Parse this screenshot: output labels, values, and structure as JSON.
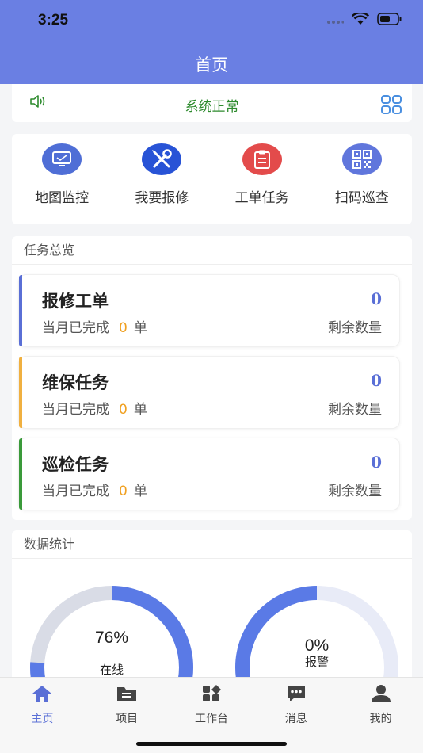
{
  "status_bar": {
    "time": "3:25"
  },
  "header": {
    "title": "首页"
  },
  "notice": {
    "status_text": "系统正常"
  },
  "quick_actions": [
    {
      "label": "地图监控",
      "icon": "monitor-icon",
      "color": "#4f6ed6"
    },
    {
      "label": "我要报修",
      "icon": "wrench-screwdriver-icon",
      "color": "#2853d6"
    },
    {
      "label": "工单任务",
      "icon": "clipboard-icon",
      "color": "#e34b4b"
    },
    {
      "label": "扫码巡查",
      "icon": "qr-code-icon",
      "color": "#6076dc"
    }
  ],
  "overview": {
    "title": "任务总览",
    "tasks": [
      {
        "name": "报修工单",
        "count": "0",
        "done_prefix": "当月已完成",
        "done_value": "0",
        "done_unit": "单",
        "remain_label": "剩余数量",
        "accent": "#5a6fd6"
      },
      {
        "name": "维保任务",
        "count": "0",
        "done_prefix": "当月已完成",
        "done_value": "0",
        "done_unit": "单",
        "remain_label": "剩余数量",
        "accent": "#f0b040"
      },
      {
        "name": "巡检任务",
        "count": "0",
        "done_prefix": "当月已完成",
        "done_value": "0",
        "done_unit": "单",
        "remain_label": "剩余数量",
        "accent": "#3a9a3a"
      }
    ]
  },
  "stats": {
    "title": "数据统计",
    "gauges": [
      {
        "percent": "76%",
        "label": "在线",
        "fraction": 0.76
      },
      {
        "percent": "0%",
        "label": "报警",
        "fraction": 0.0
      }
    ]
  },
  "tabbar": {
    "items": [
      {
        "label": "主页",
        "icon": "home-icon",
        "active": true
      },
      {
        "label": "项目",
        "icon": "folder-icon",
        "active": false
      },
      {
        "label": "工作台",
        "icon": "dashboard-icon",
        "active": false
      },
      {
        "label": "消息",
        "icon": "message-icon",
        "active": false
      },
      {
        "label": "我的",
        "icon": "user-icon",
        "active": false
      }
    ]
  },
  "colors": {
    "primary": "#6a7fe3",
    "accent_blue": "#5a6fd6",
    "ok_green": "#2e8b2e",
    "warn_orange": "#f0a020"
  }
}
